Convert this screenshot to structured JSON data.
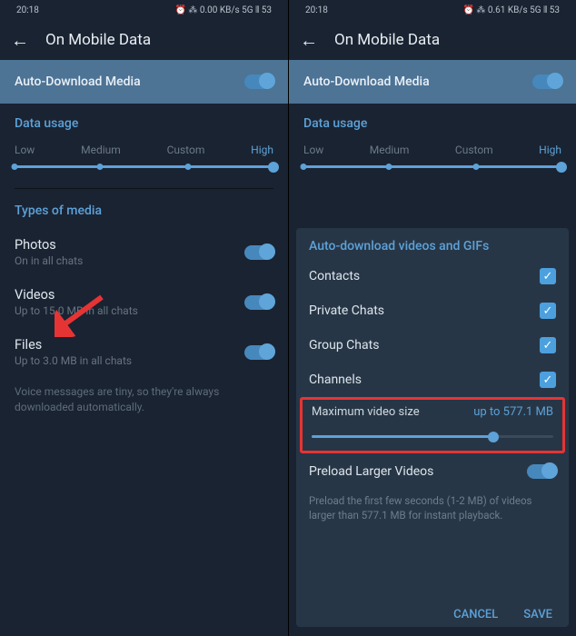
{
  "statusbar": {
    "time": "20:18",
    "indicators": "⏰ ⁂ 0.00 KB/s 5G ⫴ 53"
  },
  "statusbar2": {
    "time": "20:18",
    "indicators": "⏰ ⁂ 0.61 KB/s 5G ⫴ 53"
  },
  "header": {
    "title": "On Mobile Data"
  },
  "banner": {
    "label": "Auto-Download Media"
  },
  "usage": {
    "title": "Data usage",
    "levels": [
      "Low",
      "Medium",
      "Custom",
      "High"
    ]
  },
  "types": {
    "title": "Types of media",
    "photos": {
      "label": "Photos",
      "sub": "On in all chats"
    },
    "videos": {
      "label": "Videos",
      "sub": "Up to 15.0 MB in all chats"
    },
    "files": {
      "label": "Files",
      "sub": "Up to 3.0 MB in all chats"
    },
    "note": "Voice messages are tiny, so they're always downloaded automatically."
  },
  "sheet": {
    "title": "Auto-download videos and GIFs",
    "items": [
      "Contacts",
      "Private Chats",
      "Group Chats",
      "Channels"
    ],
    "maxsize": {
      "label": "Maximum video size",
      "value": "up to 577.1 MB"
    },
    "preload": {
      "label": "Preload Larger Videos"
    },
    "preload_note": "Preload the first few seconds (1-2 MB) of videos larger than 577.1 MB for instant playback.",
    "cancel": "CANCEL",
    "save": "SAVE"
  }
}
